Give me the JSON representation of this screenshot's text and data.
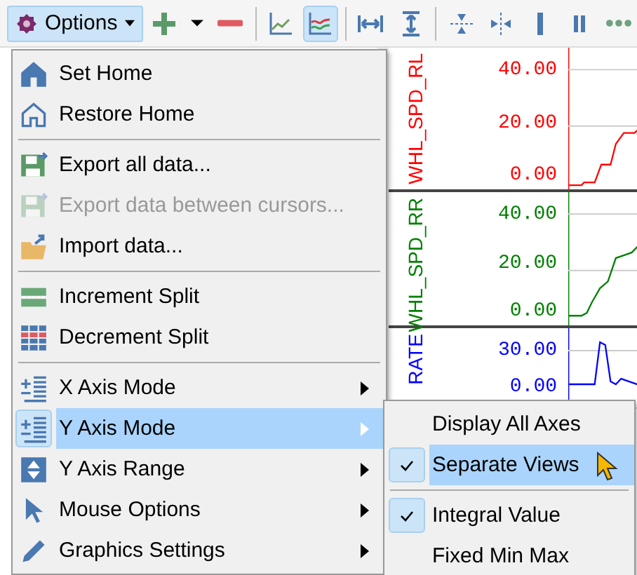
{
  "toolbar": {
    "options_button": {
      "label": "Options",
      "pressed": true
    },
    "tools": [
      {
        "kind": "plus",
        "selected": false
      },
      {
        "kind": "caret",
        "selected": false
      },
      {
        "kind": "minus",
        "selected": false
      },
      {
        "kind": "separator"
      },
      {
        "kind": "line-chart",
        "selected": false
      },
      {
        "kind": "multi-line-chart",
        "selected": true
      },
      {
        "kind": "separator"
      },
      {
        "kind": "fit-width",
        "selected": false
      },
      {
        "kind": "fit-height",
        "selected": false
      },
      {
        "kind": "separator"
      },
      {
        "kind": "split-horizontal",
        "selected": false
      },
      {
        "kind": "split-vertical",
        "selected": false
      },
      {
        "kind": "bar",
        "selected": false
      },
      {
        "kind": "double-bar",
        "selected": false
      },
      {
        "kind": "dots",
        "selected": false
      }
    ]
  },
  "chart_panes": [
    {
      "name": "WHL_SPD_RL",
      "color": "#ff0000",
      "ticks": [
        "40.00",
        "20.00",
        "0.00"
      ]
    },
    {
      "name": "WHL_SPD_RR",
      "color": "#008000",
      "ticks": [
        "40.00",
        "20.00",
        "0.00"
      ]
    },
    {
      "name": "RATE",
      "color": "#0000ff",
      "ticks": [
        "30.00",
        "0.00"
      ]
    }
  ],
  "menu": [
    {
      "kind": "item",
      "label": "Set Home",
      "disabled": false,
      "submenu": false,
      "selected": false
    },
    {
      "kind": "item",
      "label": "Restore Home",
      "disabled": false,
      "submenu": false,
      "selected": false
    },
    {
      "kind": "separator"
    },
    {
      "kind": "item",
      "label": "Export all data...",
      "disabled": false,
      "submenu": false,
      "selected": false
    },
    {
      "kind": "item",
      "label": "Export data between cursors...",
      "disabled": true,
      "submenu": false,
      "selected": false
    },
    {
      "kind": "item",
      "label": "Import data...",
      "disabled": false,
      "submenu": false,
      "selected": false
    },
    {
      "kind": "separator"
    },
    {
      "kind": "item",
      "label": "Increment Split",
      "disabled": false,
      "submenu": false,
      "selected": false
    },
    {
      "kind": "item",
      "label": "Decrement Split",
      "disabled": false,
      "submenu": false,
      "selected": false
    },
    {
      "kind": "separator"
    },
    {
      "kind": "item",
      "label": "X Axis Mode",
      "disabled": false,
      "submenu": true,
      "selected": false
    },
    {
      "kind": "item",
      "label": "Y Axis Mode",
      "disabled": false,
      "submenu": true,
      "selected": true
    },
    {
      "kind": "item",
      "label": "Y Axis Range",
      "disabled": false,
      "submenu": true,
      "selected": false
    },
    {
      "kind": "item",
      "label": "Mouse Options",
      "disabled": false,
      "submenu": true,
      "selected": false
    },
    {
      "kind": "item",
      "label": "Graphics Settings",
      "disabled": false,
      "submenu": true,
      "selected": false
    }
  ],
  "submenu": [
    {
      "kind": "item",
      "label": "Display All Axes",
      "checked": false,
      "selected": false
    },
    {
      "kind": "item",
      "label": "Separate Views",
      "checked": true,
      "selected": true
    },
    {
      "kind": "separator"
    },
    {
      "kind": "item",
      "label": "Integral Value",
      "checked": true,
      "selected": false
    },
    {
      "kind": "item",
      "label": "Fixed Min Max",
      "checked": false,
      "selected": false
    }
  ]
}
